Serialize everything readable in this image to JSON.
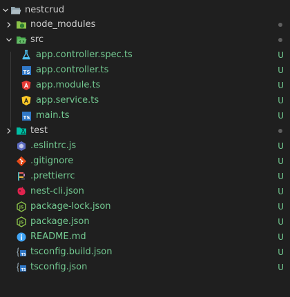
{
  "explorer": {
    "root": {
      "name": "nestcrud"
    },
    "items": [
      {
        "name": "node_modules",
        "kind": "folder",
        "icon": "node-modules-folder-icon",
        "status": "dot"
      },
      {
        "name": "src",
        "kind": "folder-open",
        "icon": "src-folder-icon",
        "status": "dot"
      },
      {
        "name": "app.controller.spec.ts",
        "kind": "file",
        "icon": "test-flask-icon",
        "status": "U"
      },
      {
        "name": "app.controller.ts",
        "kind": "file",
        "icon": "typescript-icon",
        "status": "U"
      },
      {
        "name": "app.module.ts",
        "kind": "file",
        "icon": "angular-icon",
        "status": "U"
      },
      {
        "name": "app.service.ts",
        "kind": "file",
        "icon": "angular-service-icon",
        "status": "U"
      },
      {
        "name": "main.ts",
        "kind": "file",
        "icon": "typescript-icon",
        "status": "U"
      },
      {
        "name": "test",
        "kind": "folder",
        "icon": "test-folder-icon",
        "status": "dot"
      },
      {
        "name": ".eslintrc.js",
        "kind": "file",
        "icon": "eslint-icon",
        "status": "U"
      },
      {
        "name": ".gitignore",
        "kind": "file",
        "icon": "git-icon",
        "status": "U"
      },
      {
        "name": ".prettierrc",
        "kind": "file",
        "icon": "prettier-icon",
        "status": "U"
      },
      {
        "name": "nest-cli.json",
        "kind": "file",
        "icon": "nest-icon",
        "status": "U"
      },
      {
        "name": "package-lock.json",
        "kind": "file",
        "icon": "nodejs-icon",
        "status": "U"
      },
      {
        "name": "package.json",
        "kind": "file",
        "icon": "nodejs-icon",
        "status": "U"
      },
      {
        "name": "README.md",
        "kind": "file",
        "icon": "info-icon",
        "status": "U"
      },
      {
        "name": "tsconfig.build.json",
        "kind": "file",
        "icon": "tsconfig-icon",
        "status": "U"
      },
      {
        "name": "tsconfig.json",
        "kind": "file",
        "icon": "tsconfig-icon",
        "status": "U"
      }
    ]
  },
  "colors": {
    "background": "#1f1f1f",
    "text": "#cccccc",
    "untracked": "#73c991",
    "dot": "#5f5f5f"
  }
}
